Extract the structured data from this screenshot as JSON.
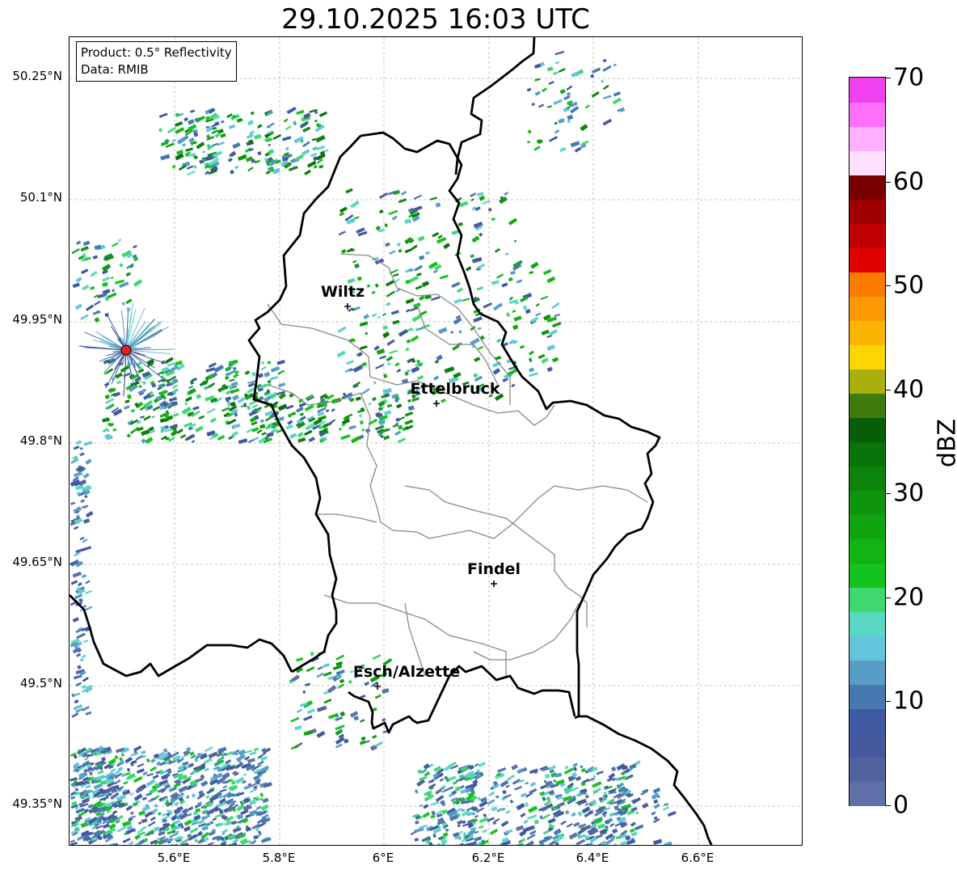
{
  "title": "29.10.2025 16:03 UTC",
  "info": {
    "product": "Product: 0.5° Reflectivity",
    "data": "Data: RMIB"
  },
  "lat_labels": [
    "50.25°N",
    "50.1°N",
    "49.95°N",
    "49.8°N",
    "49.65°N",
    "49.5°N",
    "49.35°N"
  ],
  "lon_labels": [
    "5.6°E",
    "5.8°E",
    "6°E",
    "6.2°E",
    "6.4°E",
    "6.6°E"
  ],
  "cities": [
    {
      "name": "Wiltz"
    },
    {
      "name": "Ettelbruck"
    },
    {
      "name": "Findel"
    },
    {
      "name": "Esch/Alzette"
    }
  ],
  "colorbar": {
    "unit": "dBZ",
    "min": 0,
    "max": 70,
    "tick_labels": [
      "0",
      "10",
      "20",
      "30",
      "40",
      "50",
      "60",
      "70"
    ],
    "colors": [
      "#5f70a8",
      "#51639f",
      "#46599f",
      "#3f5aa3",
      "#4878b0",
      "#579dc6",
      "#64c4dc",
      "#5ad8c4",
      "#3dd870",
      "#14c41e",
      "#12b414",
      "#10a410",
      "#0e940e",
      "#0c840c",
      "#0a740a",
      "#075e07",
      "#3f7a0c",
      "#a8b00c",
      "#fcd600",
      "#fcb400",
      "#fc9800",
      "#fc7c00",
      "#e00000",
      "#c00000",
      "#a00000",
      "#780000",
      "#ffe0ff",
      "#ffb0ff",
      "#ff70f8",
      "#f040f0"
    ]
  },
  "radar_site": {
    "color": "#e82020"
  }
}
